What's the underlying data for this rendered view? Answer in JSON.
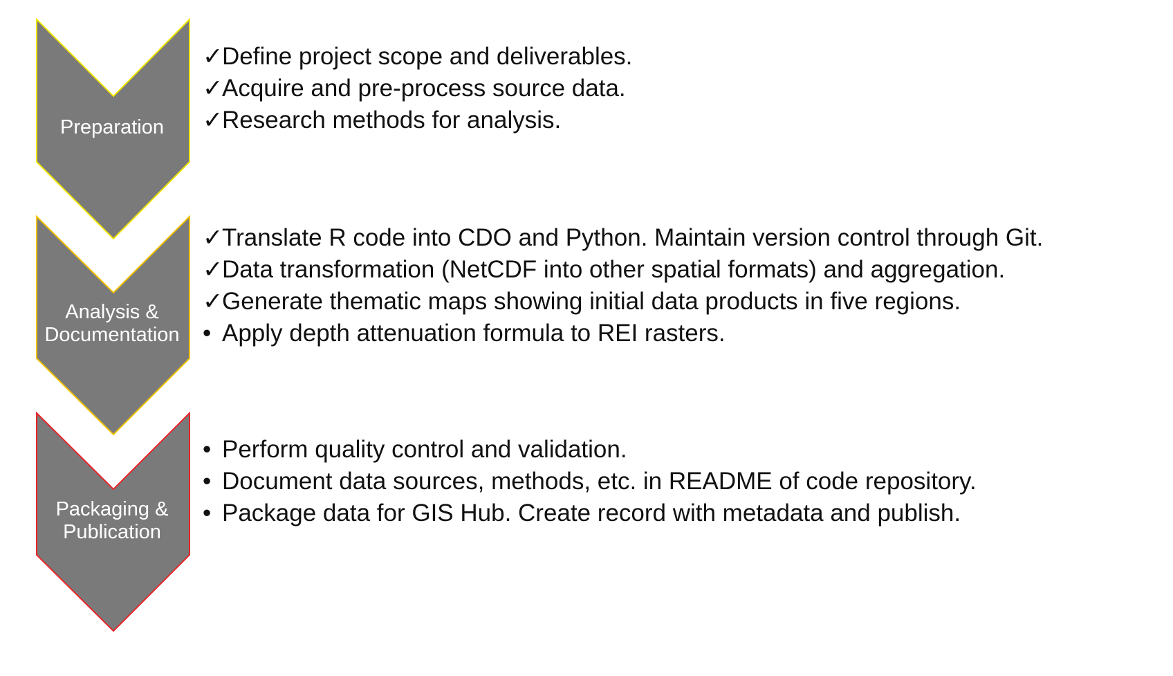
{
  "phases": [
    {
      "label": "Preparation",
      "border_color": "#f2e600",
      "fill_color": "#7a7a7a",
      "tasks": [
        {
          "marker": "✓",
          "status": "done",
          "text": "Define project scope and deliverables."
        },
        {
          "marker": "✓",
          "status": "done",
          "text": "Acquire and pre-process source data."
        },
        {
          "marker": "✓",
          "status": "done",
          "text": "Research methods for analysis."
        }
      ]
    },
    {
      "label": "Analysis &\nDocumentation",
      "border_color": "#f2c200",
      "fill_color": "#7a7a7a",
      "tasks": [
        {
          "marker": "✓",
          "status": "done",
          "text": "Translate R code into CDO and Python. Maintain version control through Git."
        },
        {
          "marker": "✓",
          "status": "done",
          "text": "Data transformation (NetCDF into other spatial formats) and aggregation."
        },
        {
          "marker": "✓",
          "status": "done",
          "text": "Generate thematic maps showing initial data products in five regions."
        },
        {
          "marker": "•",
          "status": "pending",
          "text": "Apply depth attenuation formula to REI rasters."
        }
      ]
    },
    {
      "label": "Packaging &\nPublication",
      "border_color": "#e8262a",
      "fill_color": "#7a7a7a",
      "tasks": [
        {
          "marker": "•",
          "status": "pending",
          "text": "Perform quality control and validation."
        },
        {
          "marker": "•",
          "status": "pending",
          "text": "Document data sources, methods, etc. in README of code repository."
        },
        {
          "marker": "•",
          "status": "pending",
          "text": "Package data for GIS Hub. Create record with metadata and publish."
        }
      ]
    }
  ]
}
